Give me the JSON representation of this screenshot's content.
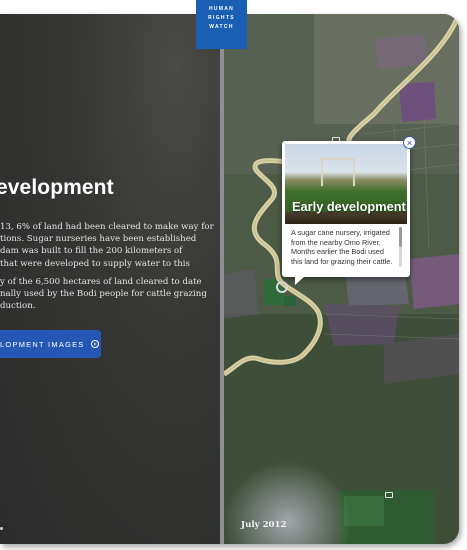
{
  "logo": {
    "lines": [
      "HUMAN",
      "RIGHTS",
      "WATCH"
    ]
  },
  "story": {
    "heading": "evelopment",
    "paragraph1": "13, 6% of land had been cleared to make way for\ntions. Sugar nurseries have been established\ndam was built to fill the 200 kilometers of\nthat were developed to supply water to this",
    "paragraph2": "y of the 6,500 hectares of land cleared to date\nnally used by the Bodi people for cattle grazing\nduction.",
    "cta_label": "LOPMENT IMAGES"
  },
  "popup": {
    "title": "Early development",
    "text": "A sugar cane nursery, irrigated\nfrom the nearby Omo River.\nMonths earlier the Bodi used\nthis land for grazing their cattle.",
    "close_symbol": "×"
  },
  "map": {
    "date_label": "July 2012"
  },
  "colors": {
    "brand_blue": "#1a5fb4",
    "cta_blue": "#2558b4",
    "panel_dark": "#333431",
    "river": "#e8dfb0"
  }
}
